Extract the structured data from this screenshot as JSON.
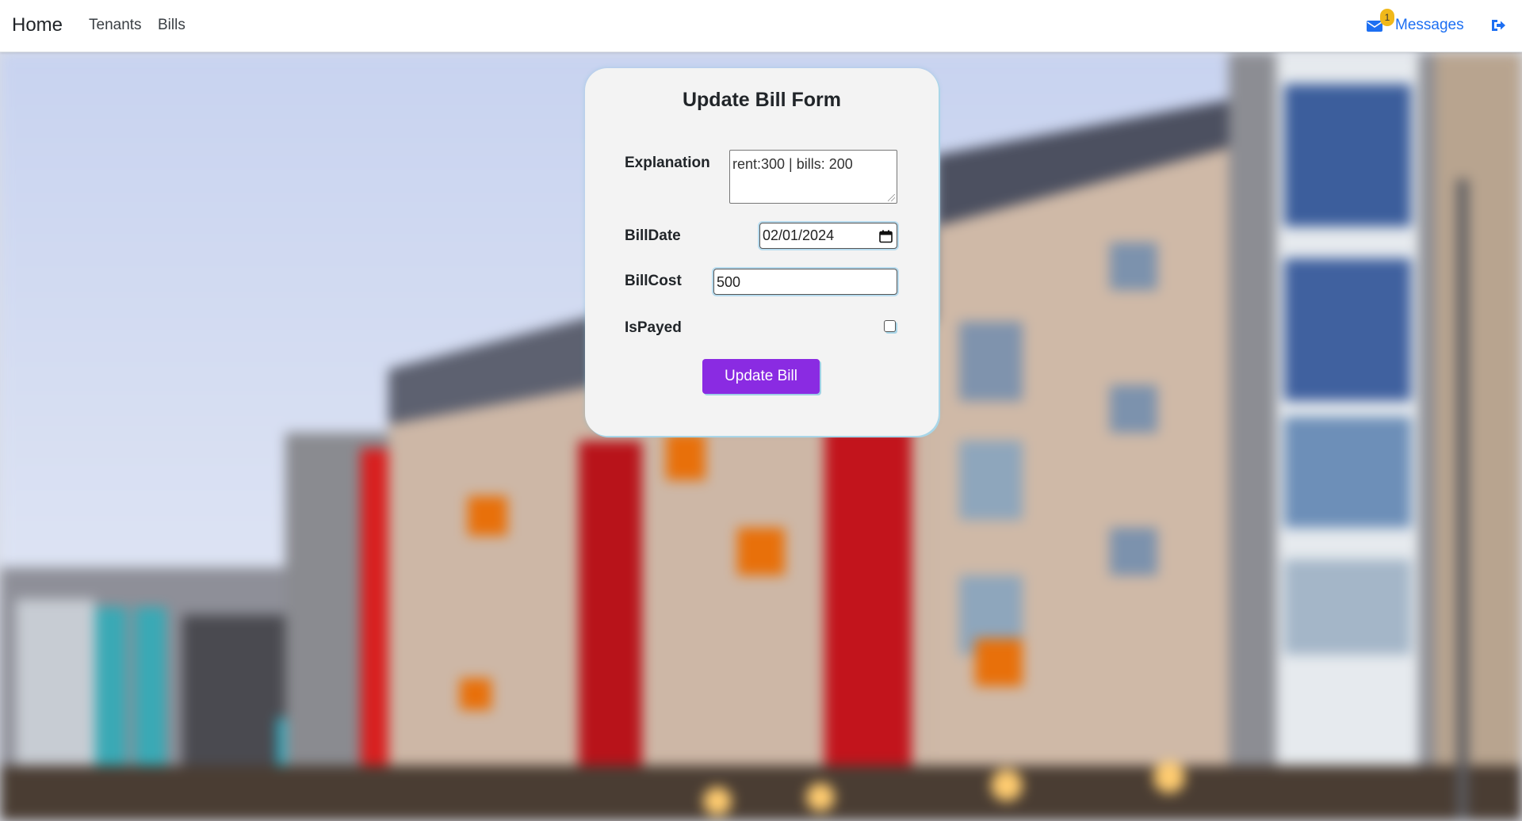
{
  "navbar": {
    "brand": "Home",
    "links": [
      "Tenants",
      "Bills"
    ],
    "messages_label": "Messages",
    "messages_badge": "1",
    "messages_icon": "envelope-icon",
    "logout_icon": "sign-out-icon",
    "link_color": "#1d6ff2",
    "badge_color": "#f0b81a"
  },
  "form": {
    "title": "Update Bill Form",
    "fields": {
      "explanation": {
        "label": "Explanation",
        "value": "rent:300  | bills: 200"
      },
      "bill_date": {
        "label": "BillDate",
        "value": "02/01/2024"
      },
      "bill_cost": {
        "label": "BillCost",
        "value": "500"
      },
      "is_payed": {
        "label": "IsPayed",
        "checked": false
      }
    },
    "submit_label": "Update Bill",
    "submit_color": "#8a2be2"
  }
}
